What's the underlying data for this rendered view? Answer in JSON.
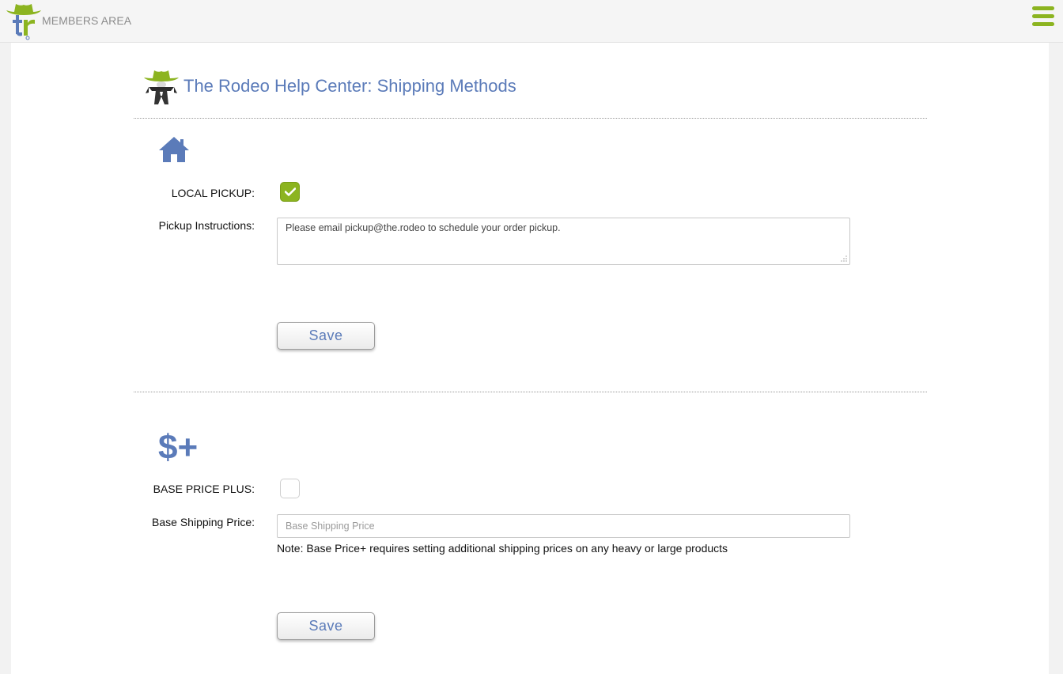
{
  "header": {
    "brand": "MEMBERS AREA",
    "menu_icon": "hamburger-menu-icon"
  },
  "page": {
    "title": "The Rodeo Help Center: Shipping Methods"
  },
  "local_pickup": {
    "icon": "house-icon",
    "label": "LOCAL PICKUP:",
    "checked": true,
    "instructions_label": "Pickup Instructions:",
    "instructions_value": "Please email pickup@the.rodeo to schedule your order pickup.",
    "save_label": "Save"
  },
  "base_price_plus": {
    "icon": "dollar-plus-icon",
    "icon_text": "$+",
    "label": "BASE PRICE PLUS:",
    "checked": false,
    "price_label": "Base Shipping Price:",
    "price_placeholder": "Base Shipping Price",
    "note": "Note: Base Price+ requires setting additional shipping prices on any heavy or large products",
    "save_label": "Save"
  },
  "colors": {
    "accent_green": "#8cb420",
    "title_blue": "#5b7bb9"
  }
}
